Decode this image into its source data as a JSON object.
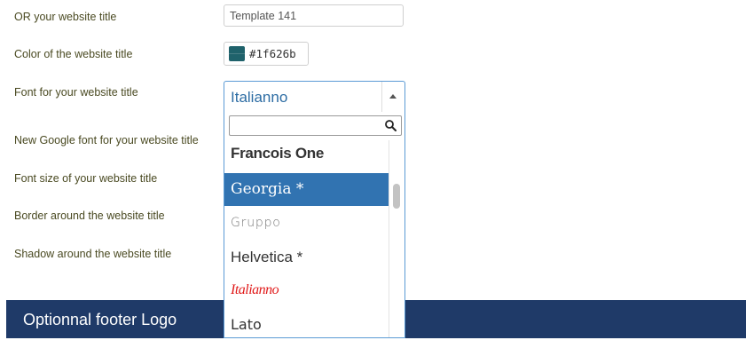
{
  "form": {
    "title_field": {
      "label": "OR your website title",
      "value": "Template 141"
    },
    "color_field": {
      "label": "Color of the website title",
      "value": "#1f626b",
      "swatch_color": "#1f626b"
    },
    "font_field": {
      "label": "Font for your website title",
      "selected": "Italianno",
      "search_placeholder": "",
      "options": [
        "Francois One",
        "Georgia *",
        "Gruppo",
        "Helvetica *",
        "Italianno",
        "Lato"
      ],
      "highlighted": "Georgia *"
    },
    "google_font_label": "New Google font for your website title",
    "font_size_label": "Font size of your website title",
    "border_label": "Border around the website title",
    "shadow_label": "Shadow around the website title"
  },
  "footer": {
    "title": "Optionnal footer Logo"
  },
  "colors": {
    "label_text": "#4a4a22",
    "selected_font_text": "#2e6da4",
    "highlight_bg": "#3173b1",
    "footer_bg": "#1f3a68",
    "italianno_preview": "#e01a1a"
  },
  "icons": {
    "search": "search-icon",
    "dropdown_toggle": "caret-up-icon"
  }
}
